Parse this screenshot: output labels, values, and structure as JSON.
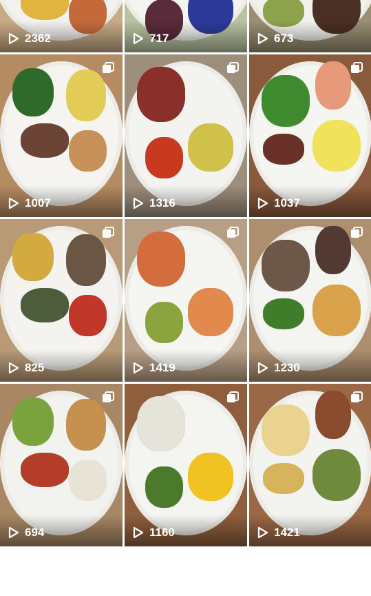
{
  "grid": {
    "tiles": [
      {
        "views": "2362",
        "multi": false,
        "bg": "#c8ab86",
        "plate": "#f3f2ee",
        "foods": [
          "#7b3d6b",
          "#3f7a2e",
          "#e1b33f",
          "#c46a3a"
        ]
      },
      {
        "views": "717",
        "multi": false,
        "bg": "#b9c3a2",
        "plate": "#f4f4f1",
        "foods": [
          "#8ccf4a",
          "#2d3a9a",
          "#5a2b3a"
        ]
      },
      {
        "views": "673",
        "multi": false,
        "bg": "#9a8f74",
        "plate": "#f1f1ee",
        "foods": [
          "#3a4aa4",
          "#f2c22a",
          "#4a2f24",
          "#8da24a"
        ]
      },
      {
        "views": "1007",
        "multi": true,
        "bg": "#b58b62",
        "plate": "#f5f4f0",
        "foods": [
          "#2f6a2a",
          "#e3cc57",
          "#6b4435",
          "#c79159"
        ]
      },
      {
        "views": "1316",
        "multi": true,
        "bg": "#9e8e7c",
        "plate": "#f3f3f0",
        "foods": [
          "#7a5442",
          "#cfc14a",
          "#c83a1f",
          "#8b2f2a"
        ]
      },
      {
        "views": "1037",
        "multi": true,
        "bg": "#8a5a3c",
        "plate": "#f5f5f2",
        "foods": [
          "#3f8a2e",
          "#e79a7a",
          "#f1e25b",
          "#6a3128"
        ]
      },
      {
        "views": "825",
        "multi": true,
        "bg": "#b89a76",
        "plate": "#f4f3ef",
        "foods": [
          "#d3aa40",
          "#6a5645",
          "#4d5c3a",
          "#c1382a"
        ]
      },
      {
        "views": "1419",
        "multi": true,
        "bg": "#b79f85",
        "plate": "#f5f5f2",
        "foods": [
          "#f4c41c",
          "#e2894e",
          "#8ca43e",
          "#d46d3e"
        ]
      },
      {
        "views": "1230",
        "multi": true,
        "bg": "#ad8f6f",
        "plate": "#f4f4f0",
        "foods": [
          "#6c5748",
          "#523a33",
          "#d9a24b",
          "#3f7d2b"
        ]
      },
      {
        "views": "694",
        "multi": true,
        "bg": "#a88764",
        "plate": "#f2f2ef",
        "foods": [
          "#7aa33f",
          "#c6904e",
          "#b43d2a",
          "#e8e3d7"
        ]
      },
      {
        "views": "1160",
        "multi": true,
        "bg": "#8f5f3d",
        "plate": "#f4f4f1",
        "foods": [
          "#b8262a",
          "#f1c224",
          "#4c7a2c",
          "#e6e3da"
        ]
      },
      {
        "views": "1421",
        "multi": true,
        "bg": "#9a6845",
        "plate": "#f3f3f0",
        "foods": [
          "#e9d38e",
          "#8a4b2f",
          "#6f8a3d",
          "#d7b45c"
        ]
      }
    ]
  },
  "icons": {
    "play": "play-icon",
    "multi": "multiple-images-icon"
  }
}
